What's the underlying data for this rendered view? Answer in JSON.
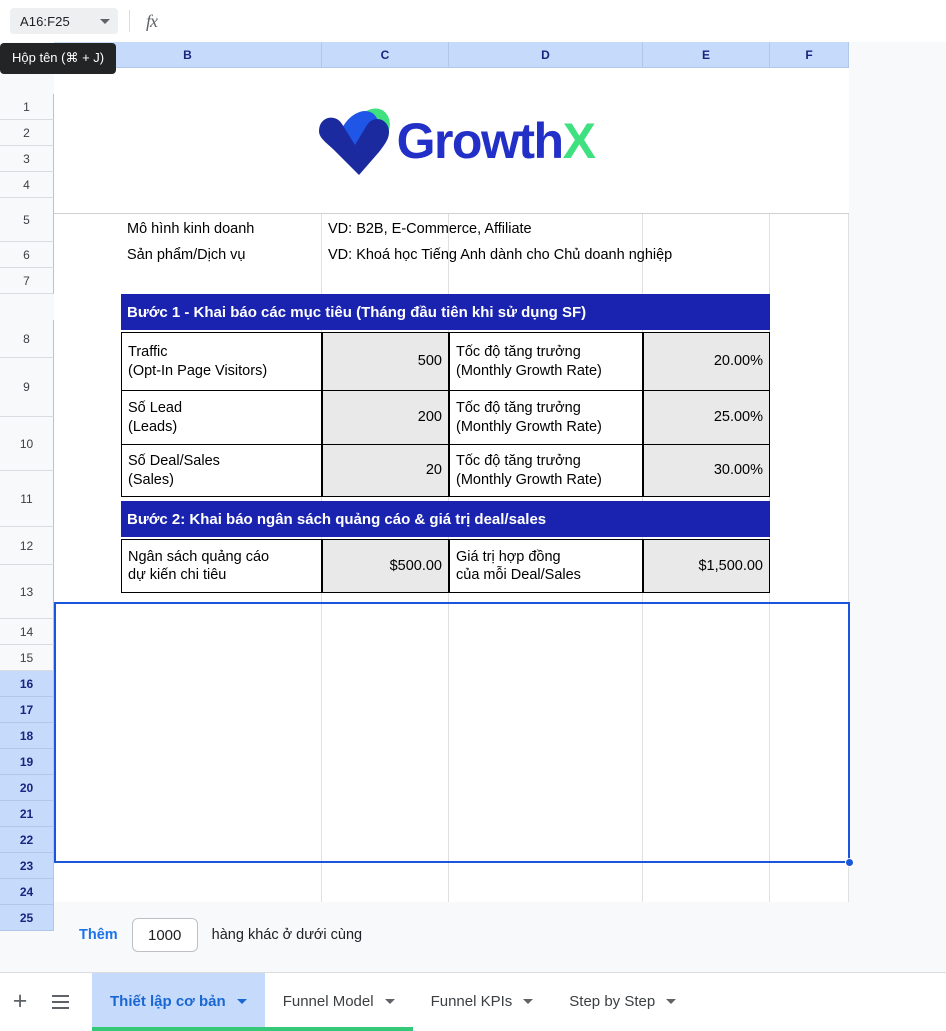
{
  "formula_bar": {
    "name_box_value": "A16:F25",
    "name_box_tooltip": "Hộp tên (⌘ + J)",
    "fx_label": "fx",
    "formula_value": ""
  },
  "grid": {
    "columns": [
      "B",
      "C",
      "D",
      "E",
      "F"
    ],
    "rows": [
      "1",
      "2",
      "3",
      "4",
      "5",
      "6",
      "7",
      "8",
      "9",
      "10",
      "11",
      "12",
      "13",
      "14",
      "15",
      "16",
      "17",
      "18",
      "19",
      "20",
      "21",
      "22",
      "23",
      "24",
      "25"
    ],
    "selected_rows": [
      "16",
      "17",
      "18",
      "19",
      "20",
      "21",
      "22",
      "23",
      "24",
      "25"
    ],
    "selected_range": "A16:F25"
  },
  "logo": {
    "word_primary": "Growth",
    "word_accent": "X",
    "color_primary": "#2330c8",
    "color_accent": "#3ee07f",
    "color_mark_dark": "#1b2a9e",
    "color_mark_blue": "#1f56e8",
    "color_mark_green": "#3ee07f"
  },
  "sheet": {
    "info_rows": [
      {
        "label": "Mô hình kinh doanh",
        "value": "VD: B2B, E-Commerce, Affiliate"
      },
      {
        "label": "Sản phẩm/Dịch vụ",
        "value": "VD: Khoá học Tiếng Anh dành cho Chủ doanh nghiệp"
      }
    ],
    "section_1": {
      "title": "Bước 1 - Khai báo các mục tiêu (Tháng đầu tiên khi sử dụng SF)",
      "color": "#1a23b0",
      "rows": [
        {
          "label_vi": "Traffic",
          "label_en": "(Opt-In Page Visitors)",
          "value": "500",
          "rate_vi": "Tốc độ tăng trưởng",
          "rate_en": "(Monthly Growth Rate)",
          "rate_value": "20.00%"
        },
        {
          "label_vi": "Số Lead",
          "label_en": "(Leads)",
          "value": "200",
          "rate_vi": "Tốc độ tăng trưởng",
          "rate_en": "(Monthly Growth Rate)",
          "rate_value": "25.00%"
        },
        {
          "label_vi": "Số Deal/Sales",
          "label_en": "(Sales)",
          "value": "20",
          "rate_vi": "Tốc độ tăng trưởng",
          "rate_en": "(Monthly Growth Rate)",
          "rate_value": "30.00%"
        }
      ]
    },
    "section_2": {
      "title": "Bước 2: Khai báo ngân sách quảng cáo & giá trị deal/sales",
      "color": "#1a23b0",
      "rows": [
        {
          "label_vi": "Ngân sách quảng cáo",
          "label_en": "dự kiến chi tiêu",
          "value": "$500.00",
          "rate_vi": "Giá trị hợp đồng",
          "rate_en": "của mỗi Deal/Sales",
          "rate_value": "$1,500.00"
        }
      ]
    }
  },
  "add_rows": {
    "link_label": "Thêm",
    "count_value": "1000",
    "tail_label": "hàng khác ở dưới cùng"
  },
  "sheet_bar": {
    "add_icon": "plus-icon",
    "all_sheets_icon": "hamburger-icon",
    "tabs": [
      {
        "label": "Thiết lập cơ bản",
        "active": true,
        "marker": true
      },
      {
        "label": "Funnel Model",
        "active": false,
        "marker": true
      },
      {
        "label": "Funnel KPIs",
        "active": false,
        "marker": false
      },
      {
        "label": "Step by Step",
        "active": false,
        "marker": false
      }
    ]
  }
}
